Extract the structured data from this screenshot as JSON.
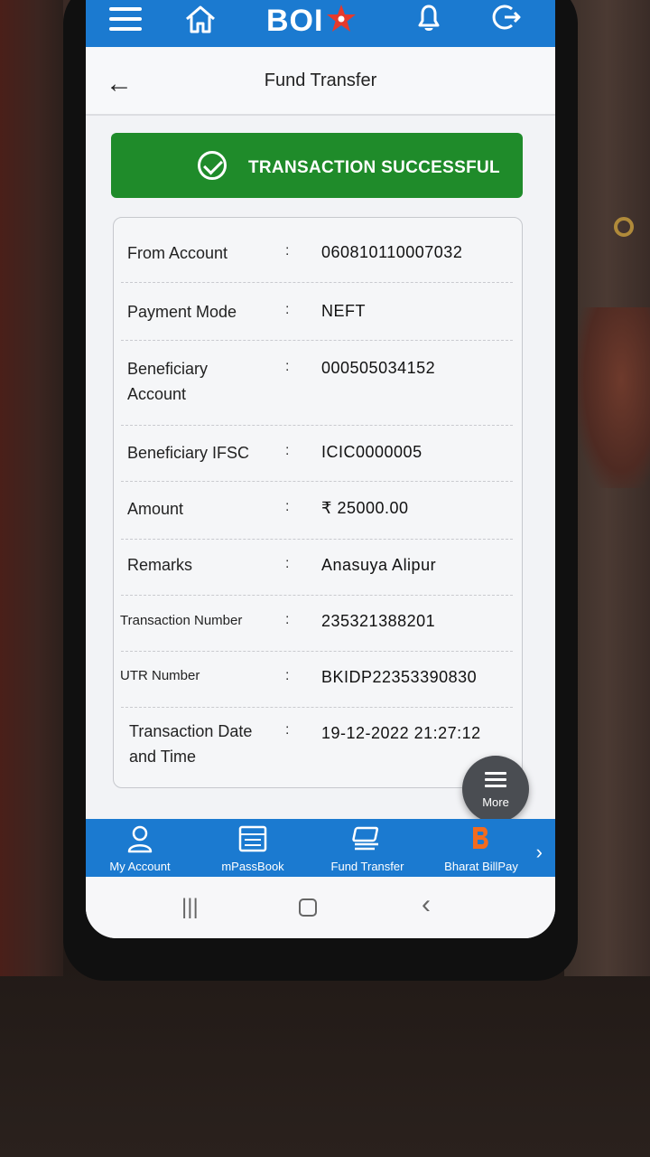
{
  "app": {
    "brand": "BOI",
    "title": "Fund Transfer"
  },
  "icons": {
    "menu": "hamburger-icon",
    "home": "home-icon",
    "notifications": "bell-icon",
    "logout": "logout-icon",
    "back": "back-arrow-icon",
    "success": "check-circle-icon"
  },
  "banner": {
    "text": "TRANSACTION SUCCESSFUL"
  },
  "details": [
    {
      "label": "From Account",
      "value": "060810110007032"
    },
    {
      "label": "Payment Mode",
      "value": "NEFT"
    },
    {
      "label_line1": "Beneficiary",
      "label_line2": "Account",
      "value": "000505034152"
    },
    {
      "label": "Beneficiary IFSC",
      "value": "ICIC0000005"
    },
    {
      "label": "Amount",
      "value": "₹ 25000.00"
    },
    {
      "label": "Remarks",
      "value": "Anasuya Alipur"
    },
    {
      "label": "Transaction Number",
      "value": "235321388201"
    },
    {
      "label": "UTR Number",
      "value": "BKIDP22353390830"
    },
    {
      "label_line1": "Transaction Date",
      "label_line2": "and Time",
      "value": "19-12-2022 21:27:12"
    }
  ],
  "colon": ":",
  "fab": {
    "label": "More"
  },
  "bottom_nav": [
    {
      "label": "My Account",
      "icon": "user-icon"
    },
    {
      "label": "mPassBook",
      "icon": "passbook-icon"
    },
    {
      "label": "Fund Transfer",
      "icon": "transfer-icon"
    },
    {
      "label": "Bharat BillPay",
      "icon": "bharat-billpay-icon"
    }
  ],
  "colors": {
    "primary_blue": "#1b7ad0",
    "success_green": "#1f8b2a",
    "brand_star": "#e53a2c"
  }
}
